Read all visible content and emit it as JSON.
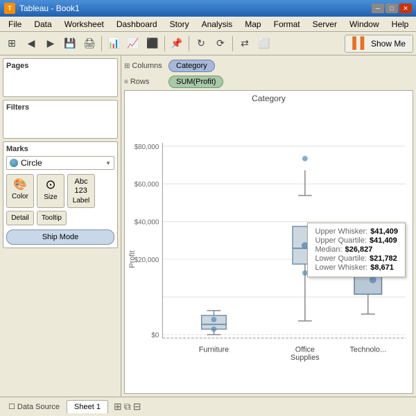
{
  "titleBar": {
    "title": "Tableau - Book1",
    "icon": "T",
    "minBtn": "─",
    "maxBtn": "□",
    "closeBtn": "✕"
  },
  "menuBar": {
    "items": [
      "File",
      "Data",
      "Worksheet",
      "Dashboard",
      "Story",
      "Analysis",
      "Map",
      "Format",
      "Server",
      "Window",
      "Help"
    ]
  },
  "toolbar": {
    "showMeLabel": "Show Me"
  },
  "shelves": {
    "columnsLabel": "Columns",
    "rowsLabel": "Rows",
    "columnsPill": "Category",
    "rowsPill": "SUM(Profit)"
  },
  "leftPanel": {
    "pagesLabel": "Pages",
    "filtersLabel": "Filters",
    "marksLabel": "Marks",
    "markType": "Circle",
    "markButtons": [
      {
        "label": "Color",
        "icon": "🎨"
      },
      {
        "label": "Size",
        "icon": "⊙"
      },
      {
        "label": "Label",
        "icon": "Abc"
      }
    ],
    "detailBtn": "Detail",
    "tooltipBtn": "Tooltip",
    "shipModeBtn": "Ship Mode"
  },
  "chart": {
    "title": "Category",
    "xLabels": [
      "Furniture",
      "Office\nSupplies",
      "Technolo..."
    ],
    "yLabels": [
      "$0",
      "$20,000",
      "$40,000",
      "$60,000",
      "$80,000"
    ],
    "profitLabel": "Profit"
  },
  "tooltip": {
    "upperWhiskerLabel": "Upper Whisker:",
    "upperWhiskerValue": "$41,409",
    "upperQuartileLabel": "Upper Quartile:",
    "upperQuartileValue": "$41,409",
    "medianLabel": "Median:",
    "medianValue": "$26,827",
    "lowerQuartileLabel": "Lower Quartile:",
    "lowerQuartileValue": "$21,782",
    "lowerWhiskerLabel": "Lower Whisker:",
    "lowerWhiskerValue": "$8,671"
  },
  "statusBar": {
    "dataSourceLabel": "Data Source",
    "sheet1Label": "Sheet 1"
  }
}
